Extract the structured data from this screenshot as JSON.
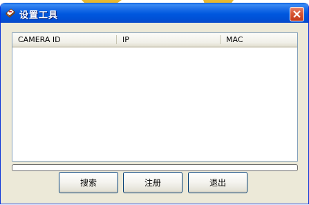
{
  "window": {
    "title": "设置工具"
  },
  "listview": {
    "columns": [
      "CAMERA ID",
      "IP",
      "MAC"
    ]
  },
  "progress": {
    "value": 0
  },
  "buttons": {
    "search": "搜索",
    "register": "注册",
    "exit": "退出"
  },
  "colors": {
    "titlebar": "#0054e3",
    "window_face": "#ece9d8",
    "close_button": "#d75634",
    "list_border": "#7f9db9"
  },
  "icons": {
    "app": "settings-tool-icon",
    "close": "close-icon"
  }
}
